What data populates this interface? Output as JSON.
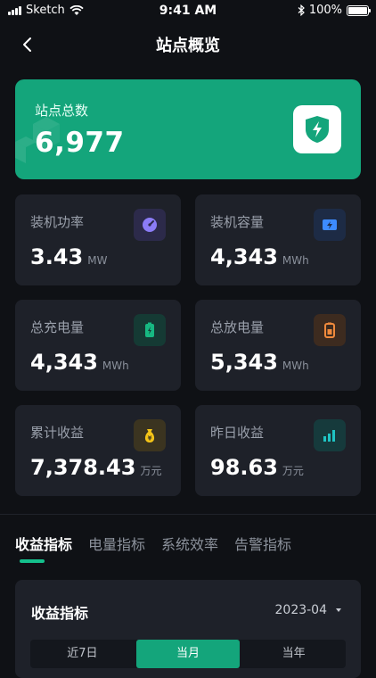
{
  "status_bar": {
    "carrier": "Sketch",
    "time": "9:41 AM",
    "battery": "100%"
  },
  "nav": {
    "title": "站点概览"
  },
  "hero": {
    "label": "站点总数",
    "value": "6,977"
  },
  "cards": [
    {
      "label": "装机功率",
      "value": "3.43",
      "unit": "MW",
      "icon": "gauge-icon",
      "icon_bg": "#2c2a4a",
      "icon_color": "#8b7cf6"
    },
    {
      "label": "装机容量",
      "value": "4,343",
      "unit": "MWh",
      "icon": "battery-bolt-icon",
      "icon_bg": "#1d2b45",
      "icon_color": "#3d8bff"
    },
    {
      "label": "总充电量",
      "value": "4,343",
      "unit": "MWh",
      "icon": "battery-charge-icon",
      "icon_bg": "#153a34",
      "icon_color": "#17b882"
    },
    {
      "label": "总放电量",
      "value": "5,343",
      "unit": "MWh",
      "icon": "battery-discharge-icon",
      "icon_bg": "#3d2b1f",
      "icon_color": "#f08a3c"
    },
    {
      "label": "累计收益",
      "value": "7,378.43",
      "unit": "万元",
      "icon": "money-bag-icon",
      "icon_bg": "#3b3420",
      "icon_color": "#f5c518"
    },
    {
      "label": "昨日收益",
      "value": "98.63",
      "unit": "万元",
      "icon": "bar-chart-icon",
      "icon_bg": "#163a3c",
      "icon_color": "#1fc4c4"
    }
  ],
  "tabs": [
    "收益指标",
    "电量指标",
    "系统效率",
    "告警指标"
  ],
  "panel": {
    "title": "收益指标",
    "date": "2023-04",
    "segments": [
      "近7日",
      "当月",
      "当年"
    ]
  },
  "colors": {
    "accent": "#14a57b",
    "background": "#0f1115",
    "card": "#1e2129"
  }
}
